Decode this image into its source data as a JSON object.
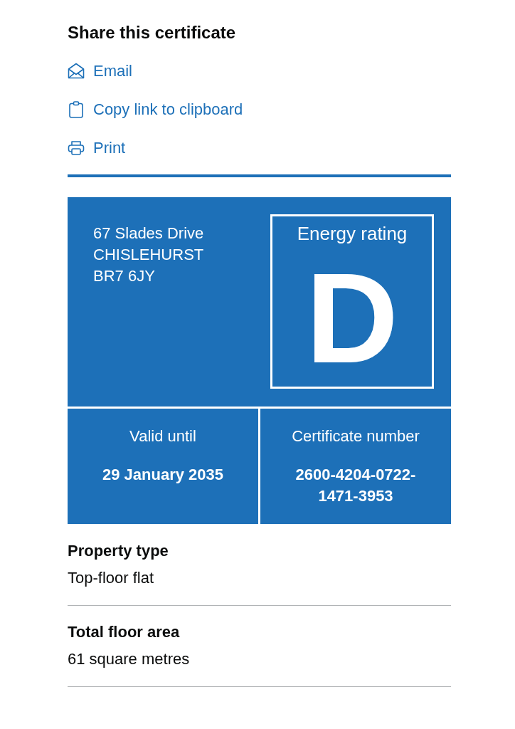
{
  "share": {
    "title": "Share this certificate",
    "links": [
      {
        "kind": "email",
        "label": "Email"
      },
      {
        "kind": "clipboard",
        "label": "Copy link to clipboard"
      },
      {
        "kind": "print",
        "label": "Print"
      }
    ]
  },
  "certificate": {
    "address": [
      "67 Slades Drive",
      "CHISLEHURST",
      "BR7 6JY"
    ],
    "energy_rating": {
      "label": "Energy rating",
      "value": "D"
    },
    "details": [
      {
        "label": "Valid until",
        "value": "29 January 2035"
      },
      {
        "label": "Certificate number",
        "value": "2600-4204-0722-1471-3953"
      }
    ]
  },
  "summary": [
    {
      "label": "Property type",
      "value": "Top-floor flat"
    },
    {
      "label": "Total floor area",
      "value": "61 square metres"
    }
  ]
}
